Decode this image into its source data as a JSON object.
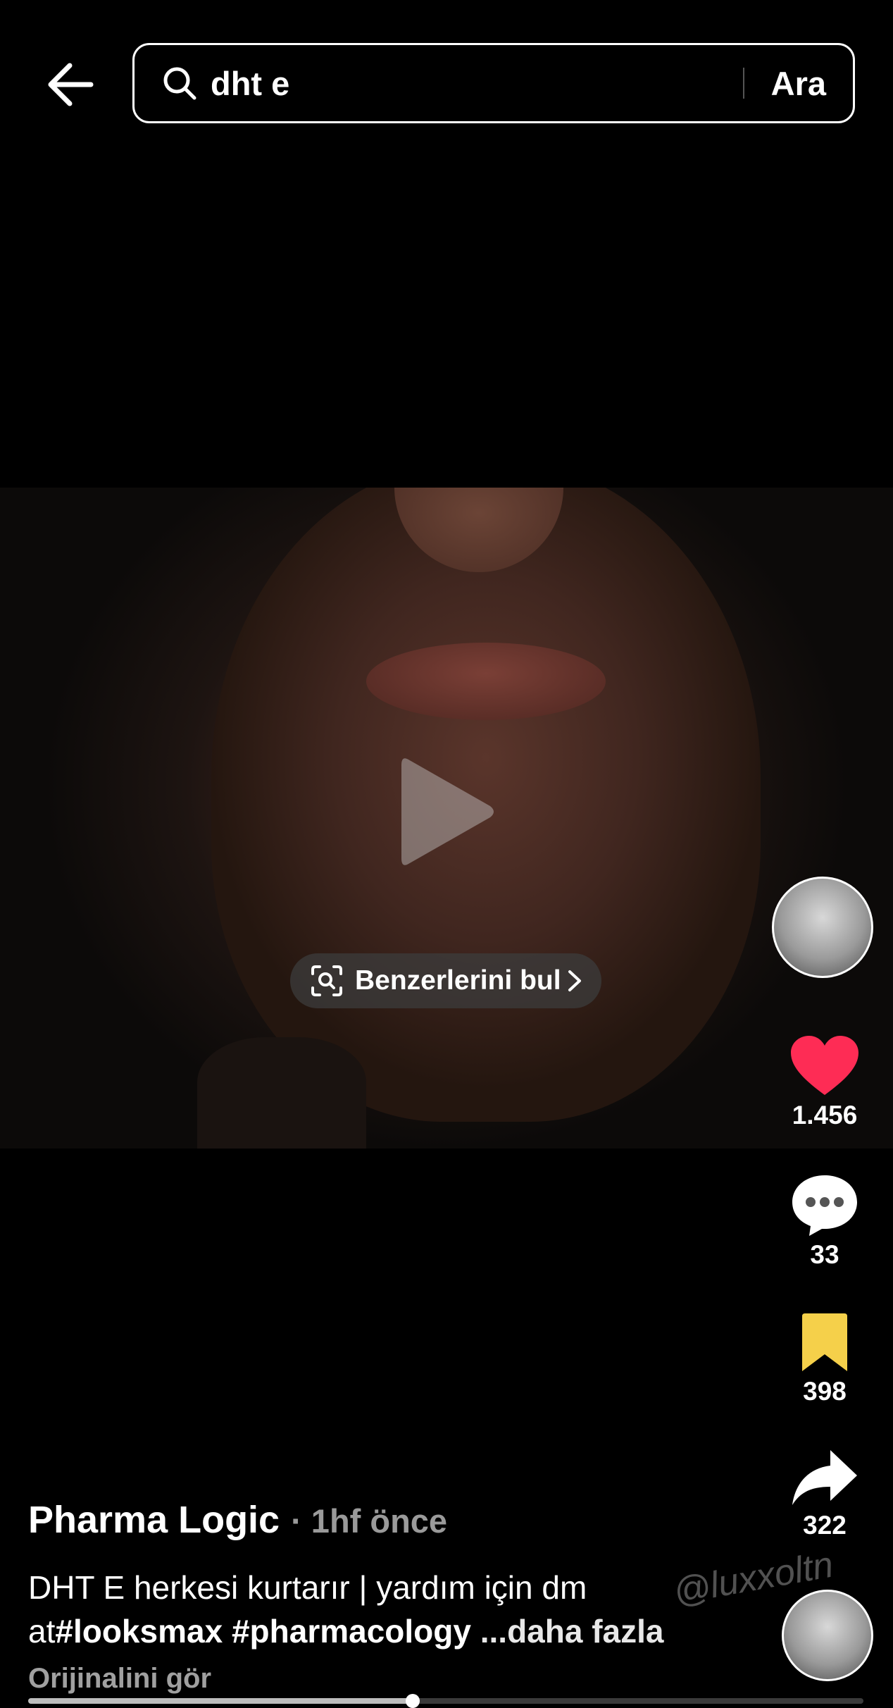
{
  "search": {
    "query": "dht e",
    "submit_label": "Ara"
  },
  "video": {
    "find_similar_label": "Benzerlerini bul",
    "watermark": "@luxxoltn",
    "progress_fraction": 0.46
  },
  "actions": {
    "likes": "1.456",
    "comments": "33",
    "saves": "398",
    "shares": "322"
  },
  "post": {
    "author": "Pharma Logic",
    "time": "· 1hf önce",
    "caption_text": "DHT E herkesi kurtarır | yardım için dm at",
    "caption_tags": "#looksmax #pharmacology",
    "caption_more": " ...daha fazla",
    "see_original": "Orijinalini gör"
  },
  "colors": {
    "like": "#fe2c55",
    "save": "#f5d04a"
  }
}
